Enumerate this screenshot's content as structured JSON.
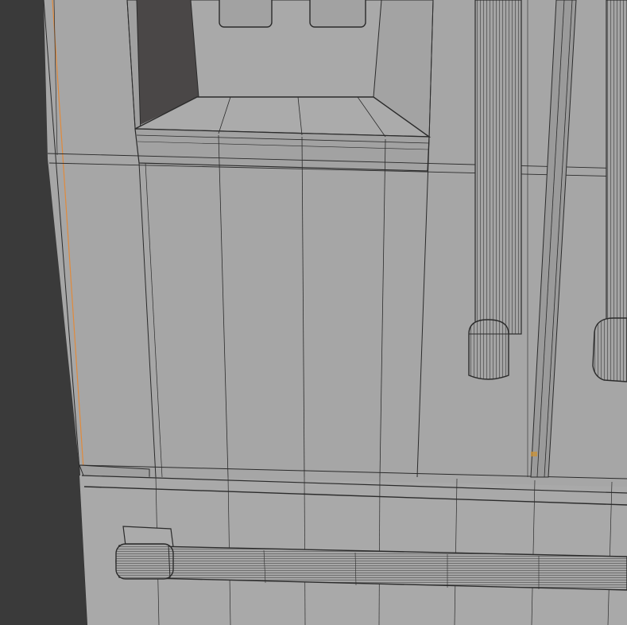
{
  "scene": {
    "description_label": "",
    "colors": {
      "background": "#3a3a3a",
      "body": "#a6a6a6",
      "body_shade": "#9c9c9c",
      "wire": "#2b2b2b",
      "recess": "#4a4747",
      "selection_edge": "#e08a3c"
    },
    "objects": [
      {
        "name": "refrigerator-body"
      },
      {
        "name": "water-dispenser-recess"
      },
      {
        "name": "dispenser-tray"
      },
      {
        "name": "left-door-handle"
      },
      {
        "name": "right-door-handle"
      },
      {
        "name": "freezer-drawer"
      },
      {
        "name": "freezer-drawer-handle"
      }
    ]
  }
}
